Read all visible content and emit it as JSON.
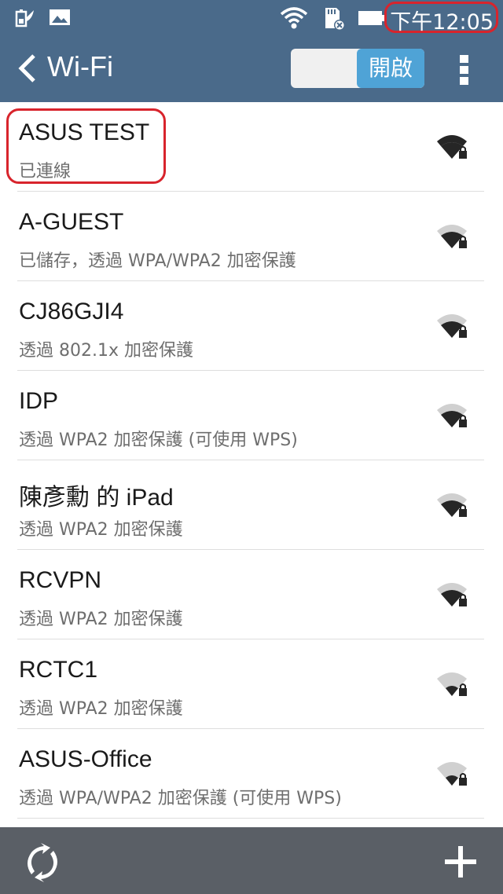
{
  "status_bar": {
    "time": "下午12:05"
  },
  "action_bar": {
    "title": "Wi-Fi",
    "toggle_label": "開啟"
  },
  "networks": [
    {
      "ssid": "ASUS TEST",
      "summary": "已連線"
    },
    {
      "ssid": "A-GUEST",
      "summary": "已儲存，透過 WPA/WPA2 加密保護"
    },
    {
      "ssid": "CJ86GJI4",
      "summary": "透過 802.1x 加密保護"
    },
    {
      "ssid": "IDP",
      "summary": "透過 WPA2 加密保護 (可使用 WPS)"
    },
    {
      "ssid": "陳彥勳 的 iPad",
      "summary": "透過 WPA2 加密保護"
    },
    {
      "ssid": "RCVPN",
      "summary": "透過 WPA2 加密保護"
    },
    {
      "ssid": "RCTC1",
      "summary": "透過 WPA2 加密保護"
    },
    {
      "ssid": "ASUS-Office",
      "summary": "透過 WPA/WPA2 加密保護 (可使用 WPS)"
    }
  ],
  "icons": {
    "status_left": [
      "battery-saver-icon",
      "image-icon"
    ],
    "status_right": [
      "wifi-icon",
      "sd-card-icon",
      "battery-icon"
    ],
    "signal": "wifi-signal-locked-icon",
    "bottom_left": "refresh-icon",
    "bottom_right": "add-icon"
  },
  "colors": {
    "bar": "#4a6a8a",
    "toggle_on": "#4fa3d6",
    "highlight": "#d8242c",
    "bottom_bar": "#5a5f66"
  }
}
